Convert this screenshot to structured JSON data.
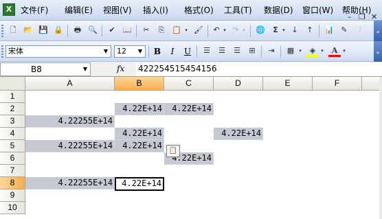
{
  "menubar": {
    "items": [
      "文件(F)",
      "编辑(E)",
      "视图(V)",
      "插入(I)",
      "格式(O)",
      "工具(T)",
      "数据(D)",
      "窗口(W)",
      "帮助(H)"
    ],
    "min": "–",
    "restore": "❐",
    "close": "✕"
  },
  "formatting": {
    "font_name": "宋体",
    "font_size": "12",
    "bold": "B",
    "italic": "I",
    "underline": "U"
  },
  "formula_bar": {
    "cell_ref": "B8",
    "fx": "fx",
    "value": "422254515454156"
  },
  "columns": [
    "A",
    "B",
    "C",
    "D",
    "E",
    "F"
  ],
  "rows": [
    "1",
    "2",
    "3",
    "4",
    "5",
    "6",
    "7",
    "8",
    "9",
    "10"
  ],
  "selected_column": "B",
  "selected_row": "8",
  "cells": {
    "B2": "4.22E+14",
    "C2": "4.22E+14",
    "A3": "4.22255E+14",
    "B4": "4.22E+14",
    "D4": "4.22E+14",
    "A5": "4.22255E+14",
    "B5": "4.22E+14",
    "C6": "4.22E+14",
    "A8": "4.22255E+14",
    "B8": "4.22E+14"
  }
}
